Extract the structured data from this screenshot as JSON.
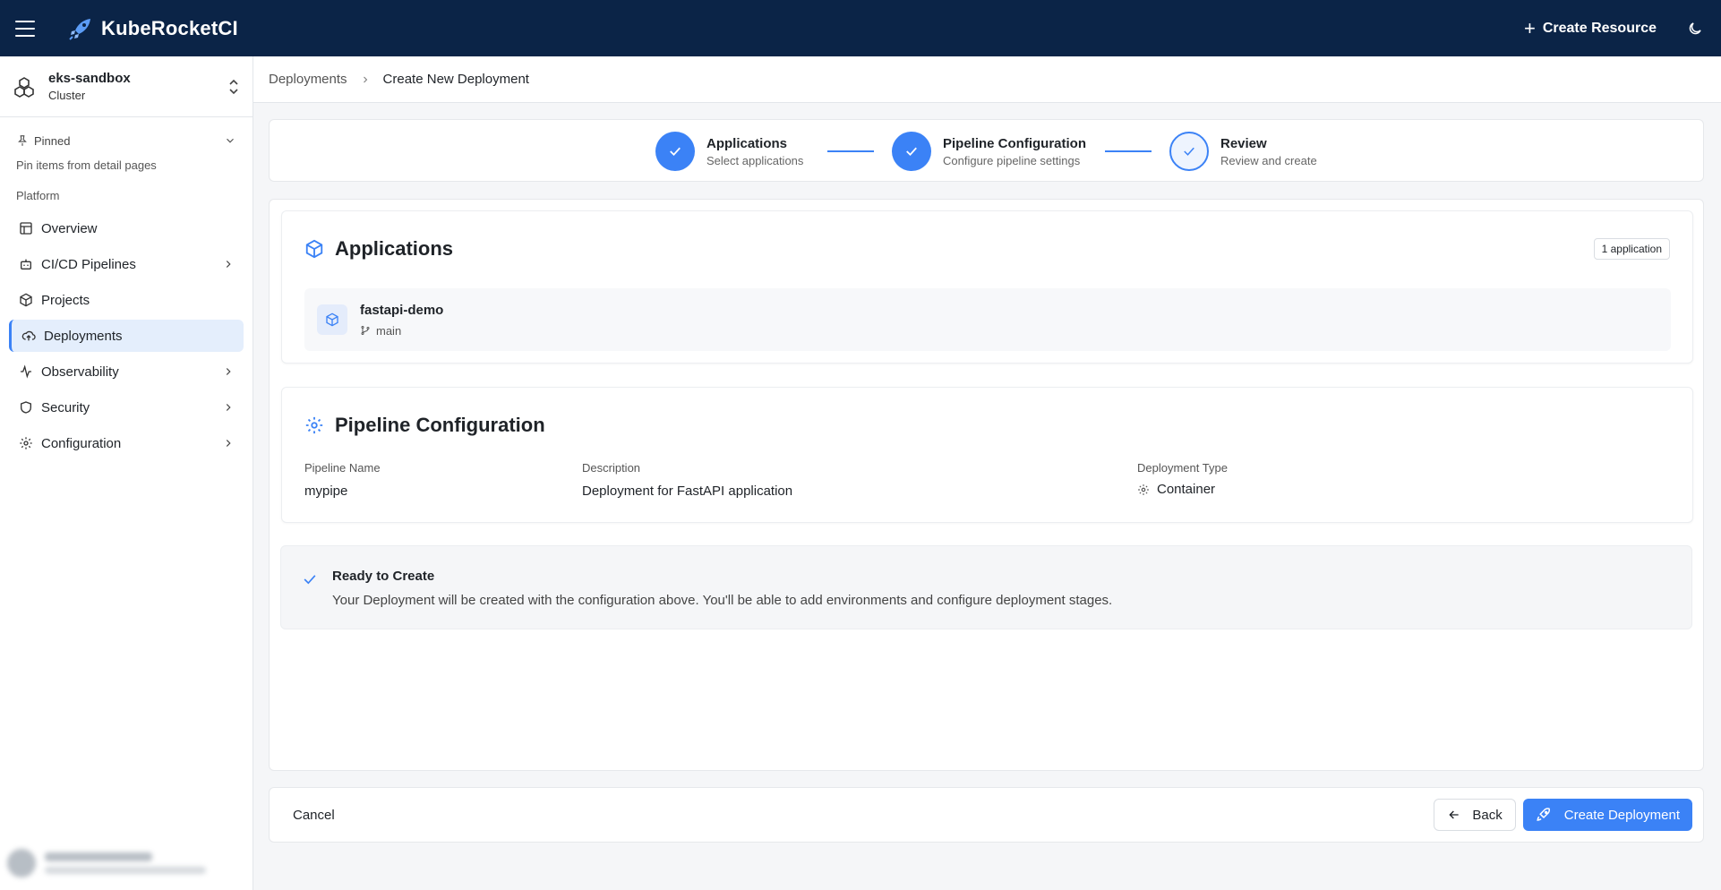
{
  "app": {
    "title": "KubeRocketCI"
  },
  "topbar": {
    "create_resource_label": "Create Resource"
  },
  "sidebar": {
    "cluster_name": "eks-sandbox",
    "cluster_type": "Cluster",
    "pinned_label": "Pinned",
    "pinned_hint": "Pin items from detail pages",
    "section_label": "Platform",
    "items": [
      {
        "label": "Overview",
        "icon": "layout-icon",
        "has_children": false,
        "active": false
      },
      {
        "label": "CI/CD Pipelines",
        "icon": "bot-icon",
        "has_children": true,
        "active": false
      },
      {
        "label": "Projects",
        "icon": "box-icon",
        "has_children": false,
        "active": false
      },
      {
        "label": "Deployments",
        "icon": "cloud-upload-icon",
        "has_children": false,
        "active": true
      },
      {
        "label": "Observability",
        "icon": "activity-icon",
        "has_children": true,
        "active": false
      },
      {
        "label": "Security",
        "icon": "shield-icon",
        "has_children": true,
        "active": false
      },
      {
        "label": "Configuration",
        "icon": "gear-icon",
        "has_children": true,
        "active": false
      }
    ]
  },
  "breadcrumb": {
    "parent": "Deployments",
    "current": "Create New Deployment"
  },
  "stepper": {
    "steps": [
      {
        "title": "Applications",
        "subtitle": "Select applications",
        "state": "complete"
      },
      {
        "title": "Pipeline Configuration",
        "subtitle": "Configure pipeline settings",
        "state": "complete"
      },
      {
        "title": "Review",
        "subtitle": "Review and create",
        "state": "current"
      }
    ]
  },
  "applications": {
    "title": "Applications",
    "count_badge": "1 application",
    "items": [
      {
        "name": "fastapi-demo",
        "branch": "main"
      }
    ]
  },
  "pipeline": {
    "title": "Pipeline Configuration",
    "name_label": "Pipeline Name",
    "name_value": "mypipe",
    "description_label": "Description",
    "description_value": "Deployment for FastAPI application",
    "type_label": "Deployment Type",
    "type_value": "Container"
  },
  "ready": {
    "title": "Ready to Create",
    "text": "Your Deployment will be created with the configuration above. You'll be able to add environments and configure deployment stages."
  },
  "footer": {
    "cancel_label": "Cancel",
    "back_label": "Back",
    "create_label": "Create Deployment"
  },
  "colors": {
    "topbar_bg": "#0b2447",
    "accent": "#3b82f6",
    "active_nav_bg": "#e4eefc"
  }
}
